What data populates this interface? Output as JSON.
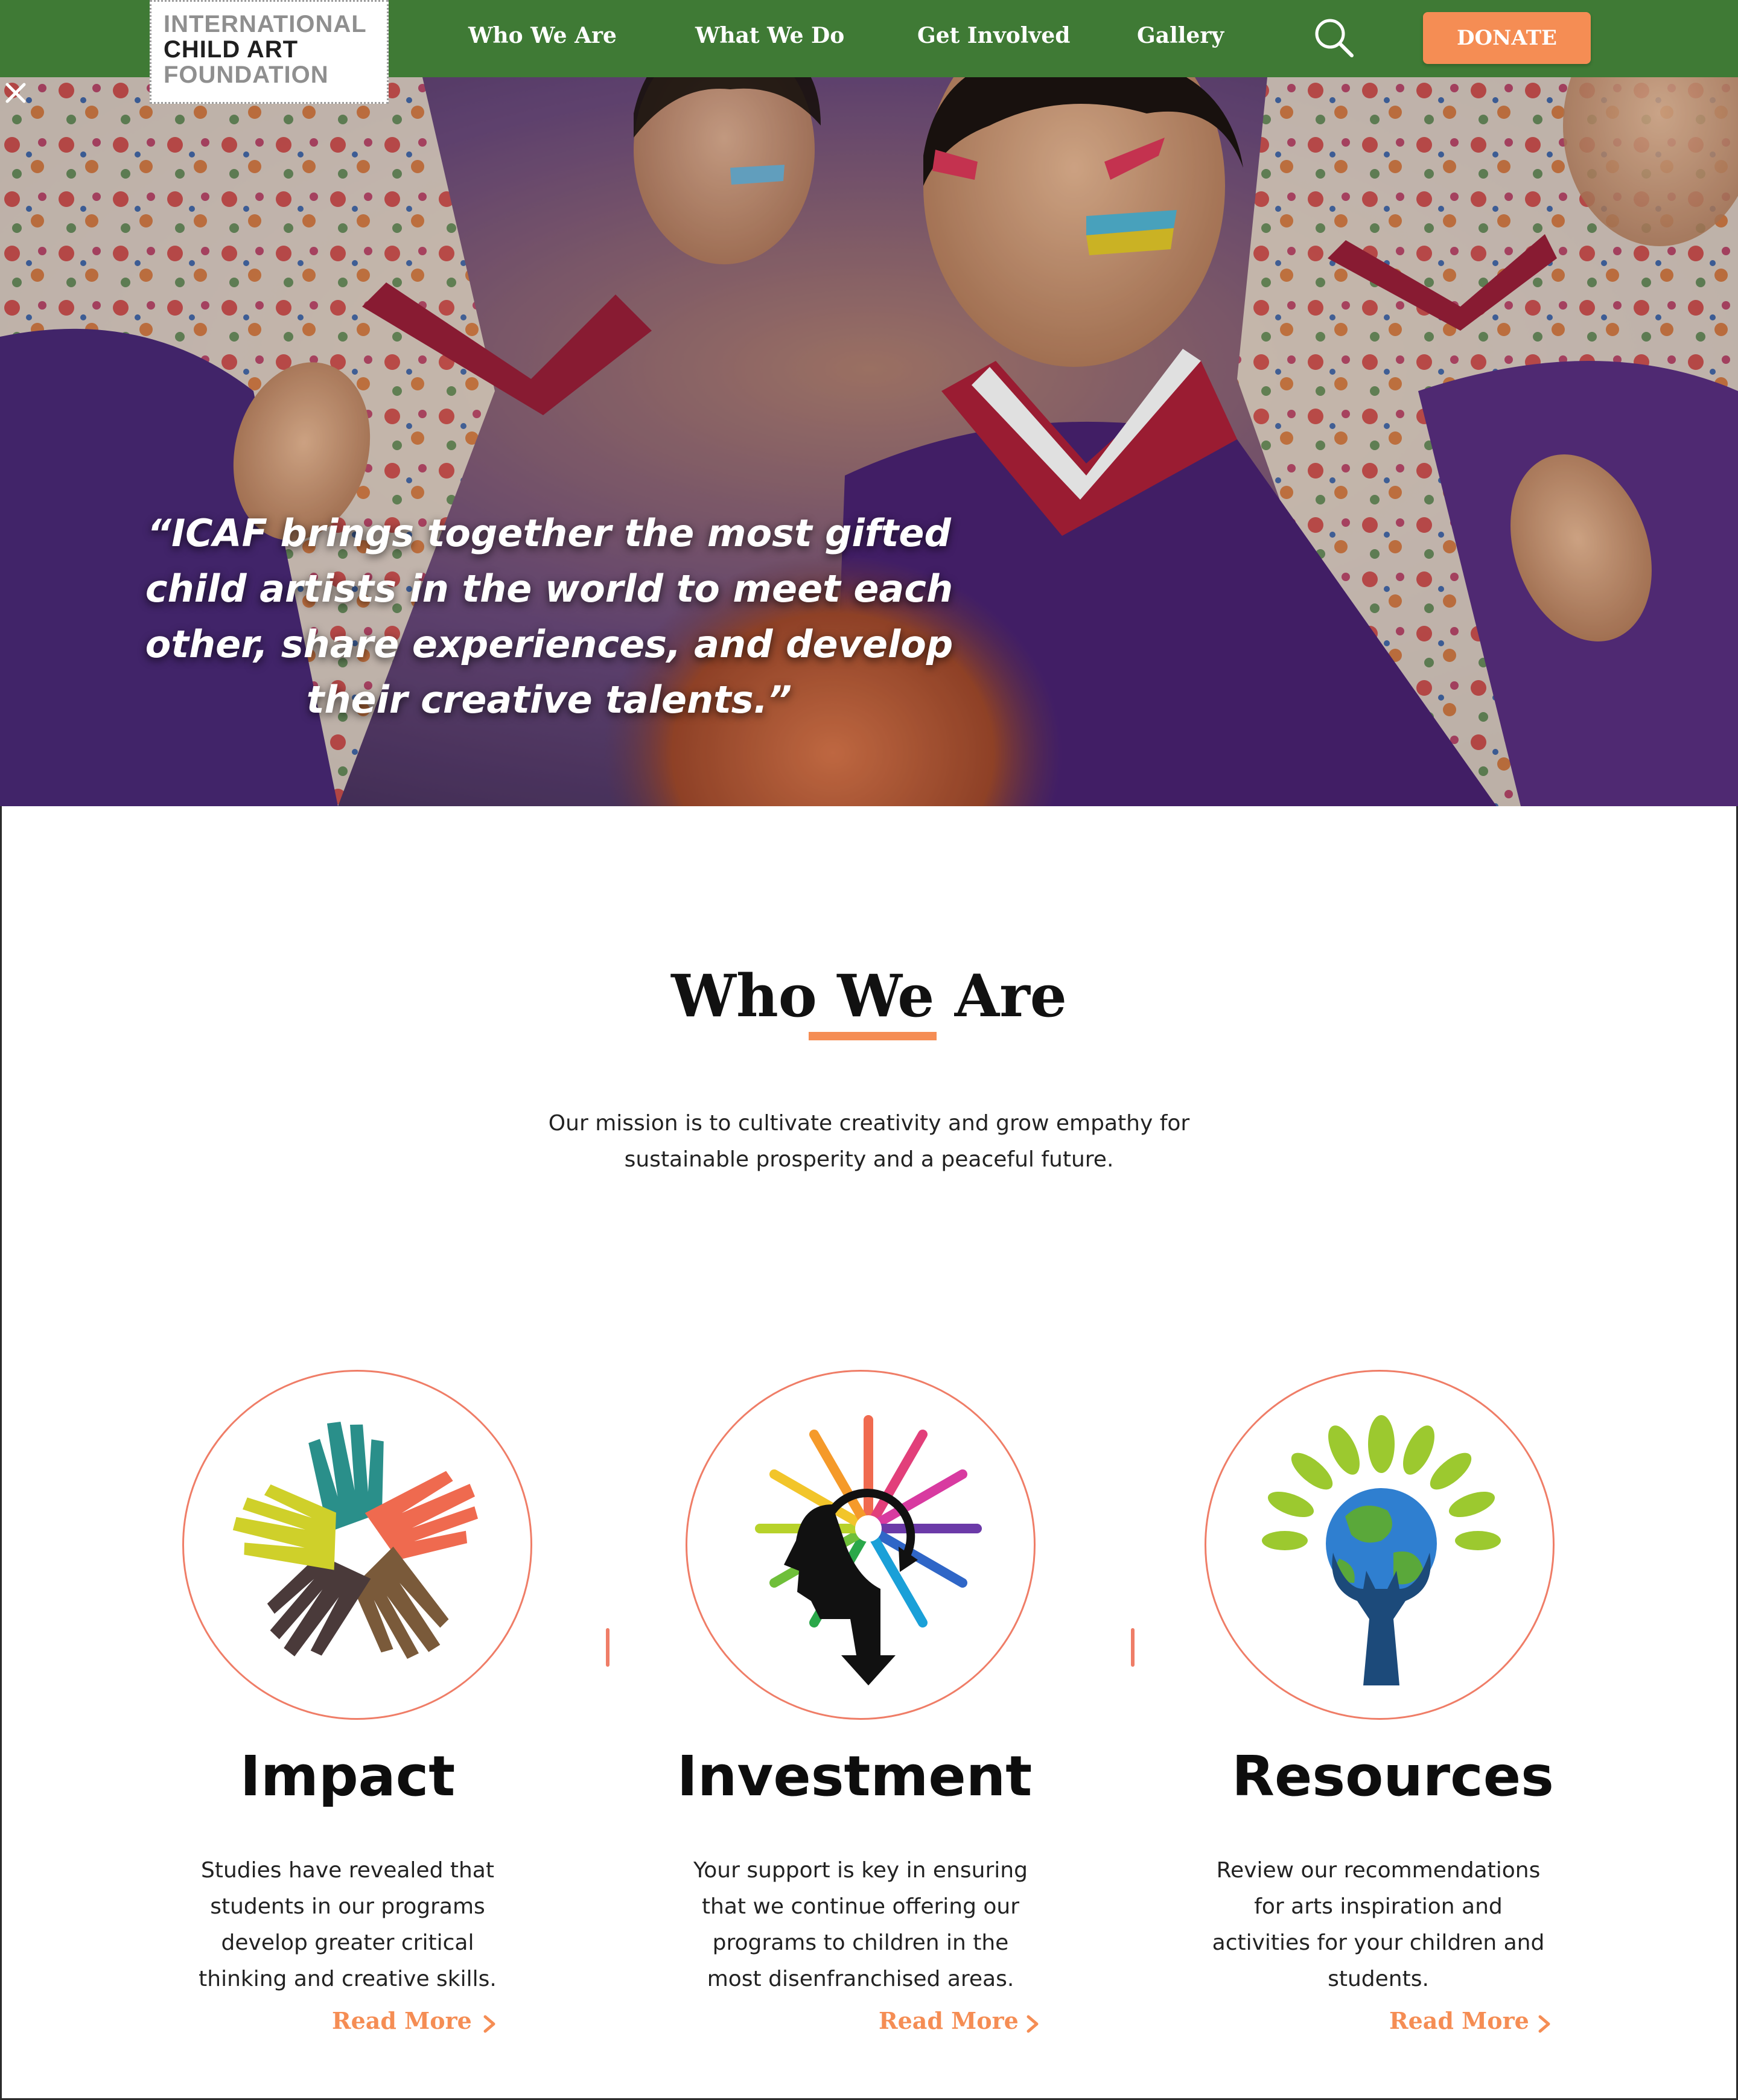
{
  "logo": {
    "line1": "INTERNATIONAL",
    "line2": "CHILD ART",
    "line3": "FOUNDATION"
  },
  "nav": {
    "items": [
      "Who We Are",
      "What We Do",
      "Get Involved",
      "Gallery"
    ],
    "donate_label": "DONATE"
  },
  "hero": {
    "quote": "“ICAF brings together the most gifted child artists in the world to meet each other, share experiences, and develop their creative talents.”"
  },
  "who_we_are": {
    "title": "Who We Are",
    "mission": "Our mission is to cultivate creativity and grow empathy for sustainable prosperity and a peaceful future."
  },
  "cards": [
    {
      "title": "Impact",
      "description": "Studies have revealed that students in our programs develop greater critical thinking and creative skills.",
      "link": "Read More",
      "icon": "hands-icon"
    },
    {
      "title": "Investment",
      "description": "Your support is key in ensuring that we continue offering our programs to children in the most disenfranchised areas.",
      "link": "Read More",
      "icon": "creative-head-icon"
    },
    {
      "title": "Resources",
      "description": "Review our recommendations for arts inspiration and activities for your children and students.",
      "link": "Read More",
      "icon": "globe-tree-icon"
    }
  ],
  "colors": {
    "nav_green": "#3f7a35",
    "accent_orange": "#f58d54",
    "circle_border": "#ef7d67"
  }
}
